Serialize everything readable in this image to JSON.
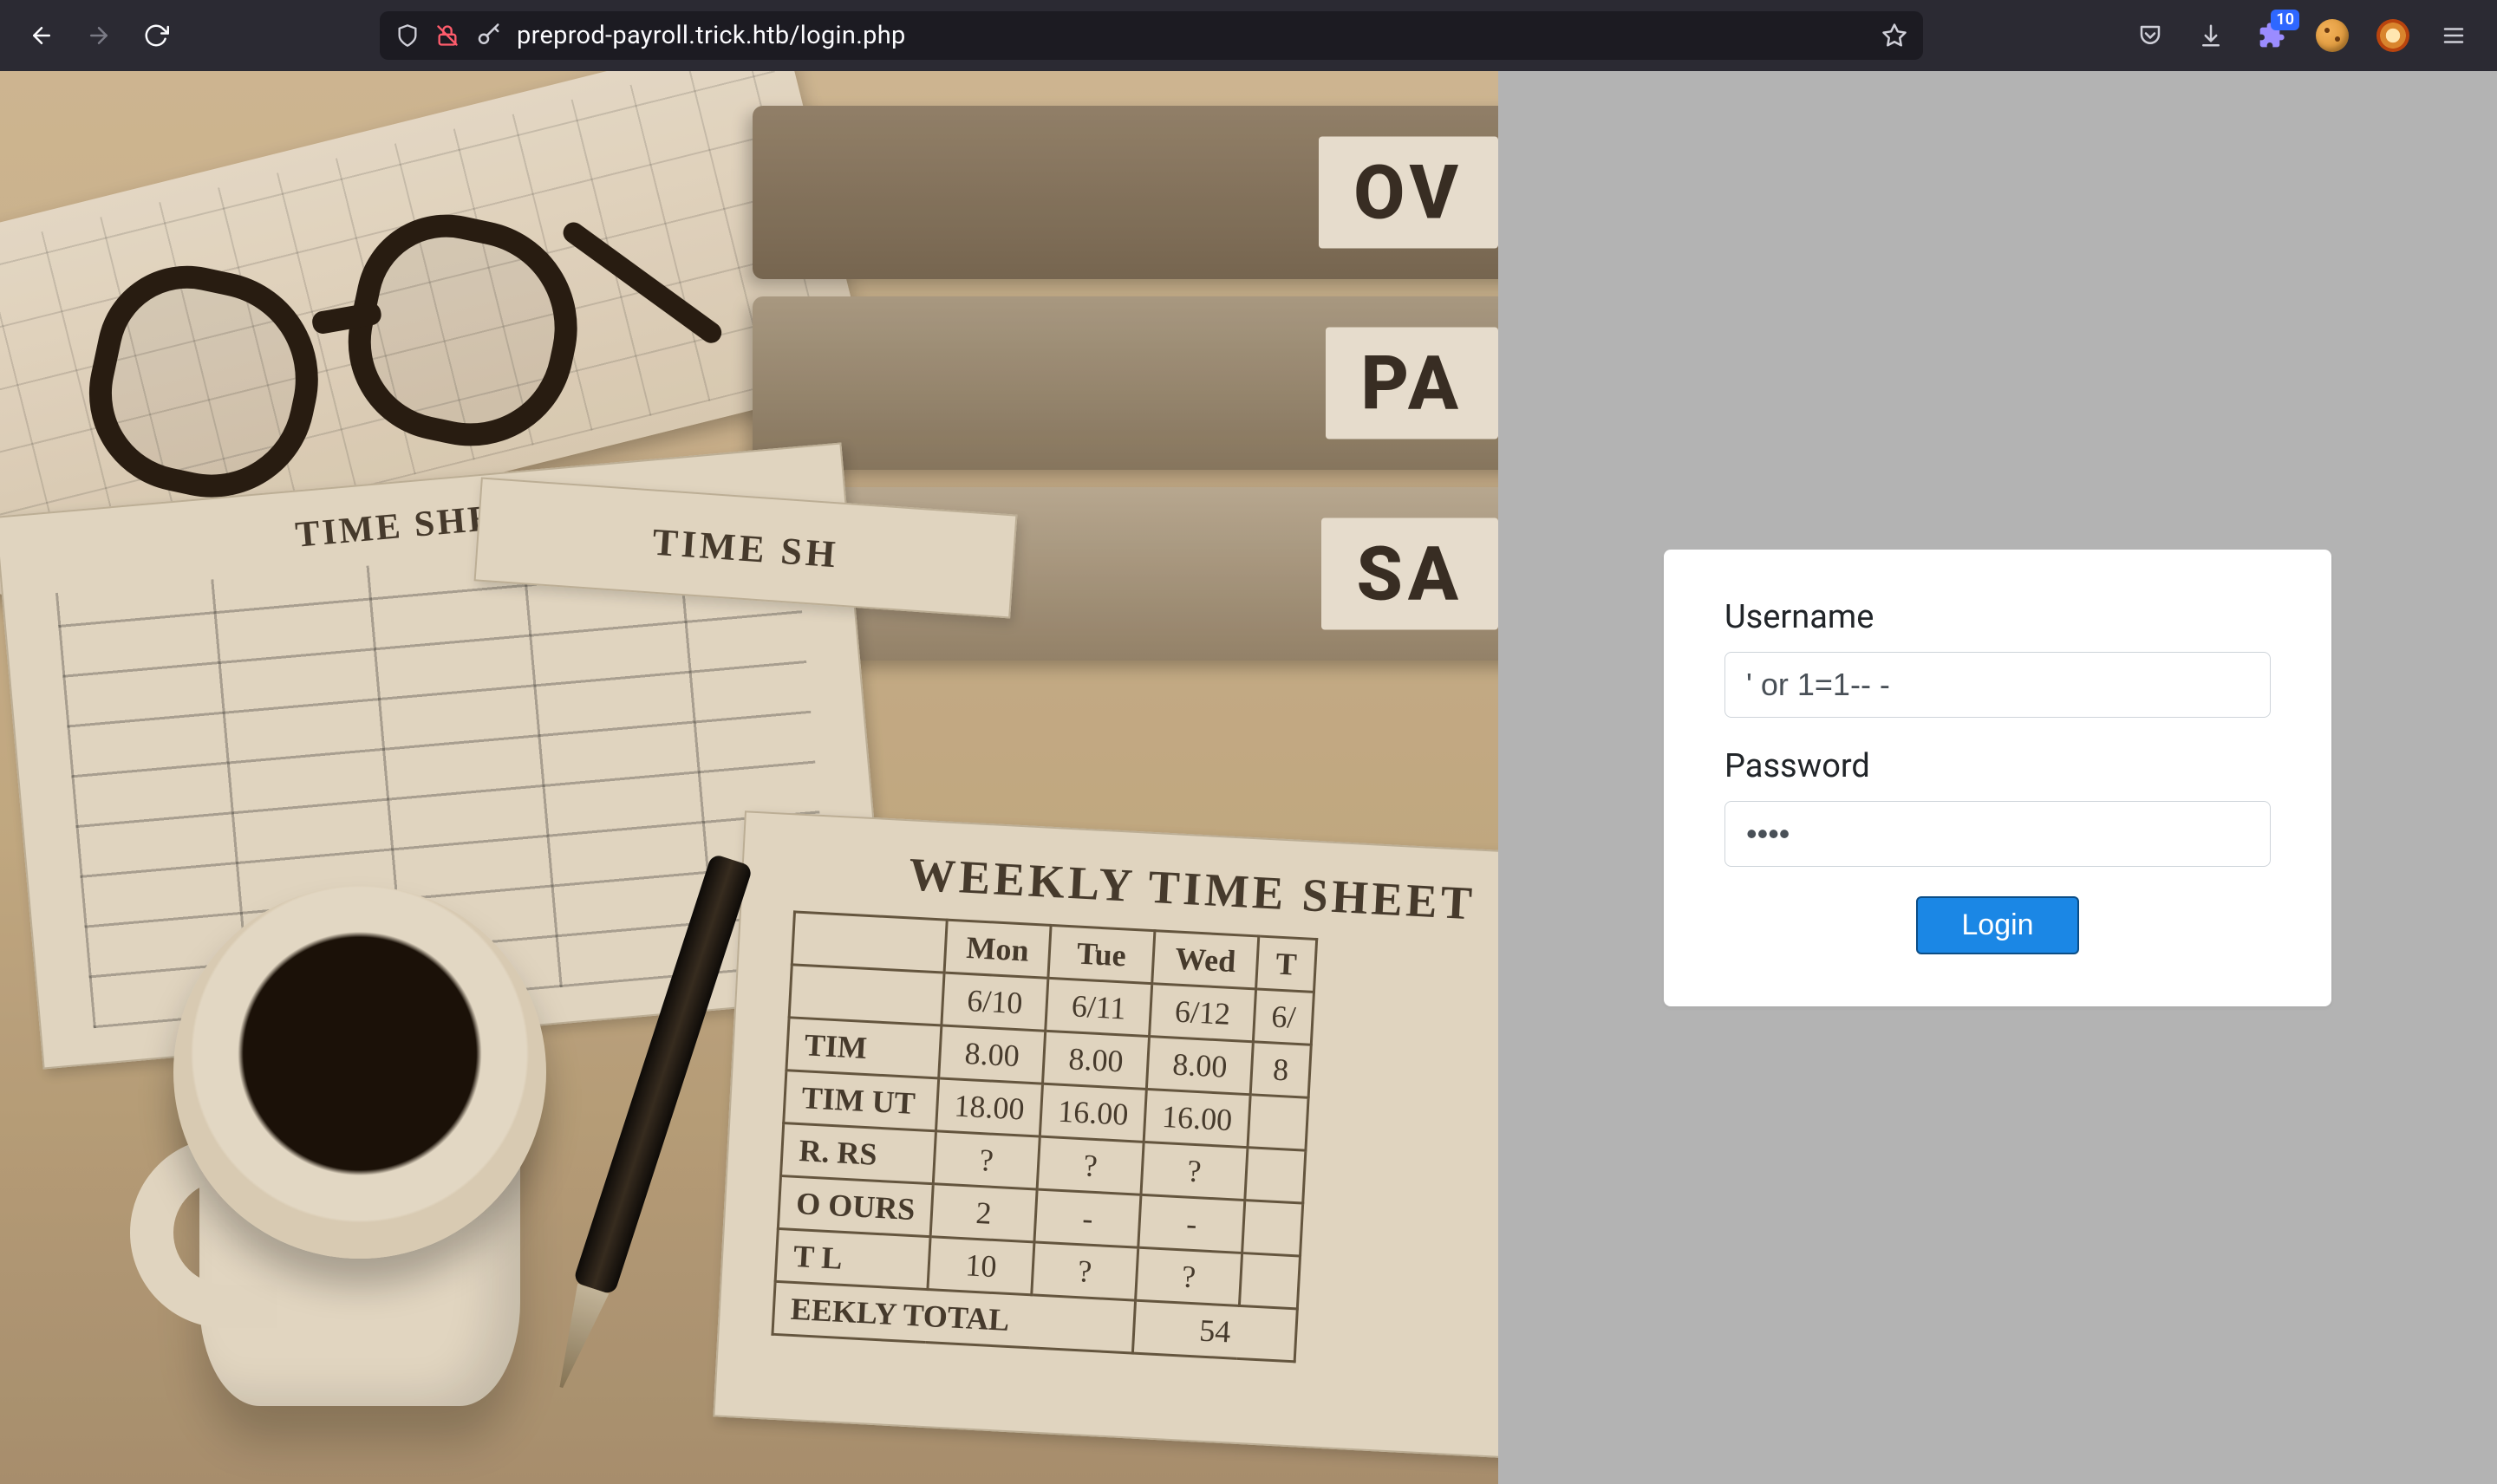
{
  "browser": {
    "url": "preprod-payroll.trick.htb/login.php",
    "extension_badge": "10"
  },
  "login": {
    "username_label": "Username",
    "username_value": "' or 1=1-- -",
    "password_label": "Password",
    "password_value": "••••",
    "submit_label": "Login"
  },
  "scene": {
    "binder_labels": [
      "OV",
      "PA",
      "SA"
    ],
    "timesheet_title": "TIME SHEET",
    "weekly_title": "WEEKLY TIME SHEET",
    "ts_header_partial": "TIME SH",
    "weekly": {
      "cols": [
        "",
        "Mon",
        "Tue",
        "Wed",
        "T"
      ],
      "dates": [
        "",
        "6/10",
        "6/11",
        "6/12",
        "6/"
      ],
      "rows": [
        {
          "label": "TIM",
          "vals": [
            "8.00",
            "8.00",
            "8.00",
            "8"
          ]
        },
        {
          "label": "TIM   UT",
          "vals": [
            "18.00",
            "16.00",
            "16.00",
            ""
          ]
        },
        {
          "label": "R.    RS",
          "vals": [
            "?",
            "?",
            "?",
            ""
          ]
        },
        {
          "label": "O     OURS",
          "vals": [
            "2",
            "-",
            "-",
            ""
          ]
        },
        {
          "label": "T     L",
          "vals": [
            "10",
            "?",
            "?",
            ""
          ]
        }
      ],
      "total_label": "EEKLY TOTAL",
      "total_value": "54"
    }
  }
}
